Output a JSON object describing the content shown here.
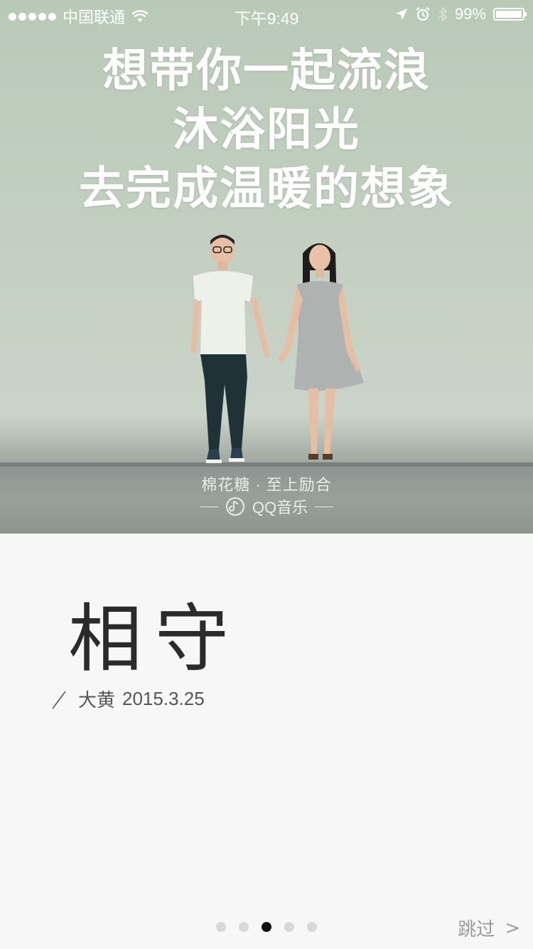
{
  "status_bar": {
    "carrier": "中国联通",
    "time": "下午9:49",
    "battery": "99%",
    "battery_level": 0.99
  },
  "hero": {
    "title_lines": [
      "想带你一起流浪",
      "沐浴阳光",
      "去完成温暖的想象"
    ],
    "caption": "棉花糖 · 至上励合",
    "brand": "QQ音乐"
  },
  "article": {
    "title": "相守",
    "author": "大黄",
    "date": "2015.3.25"
  },
  "pager": {
    "total": 5,
    "active_index": 2
  },
  "skip": {
    "label": "跳过",
    "arrow": ">"
  },
  "colors": {
    "hero_bg": "#c3d0c1",
    "page_bg": "#f7f7f7",
    "active_dot": "#111111",
    "inactive_dot": "#d8d8d8"
  }
}
